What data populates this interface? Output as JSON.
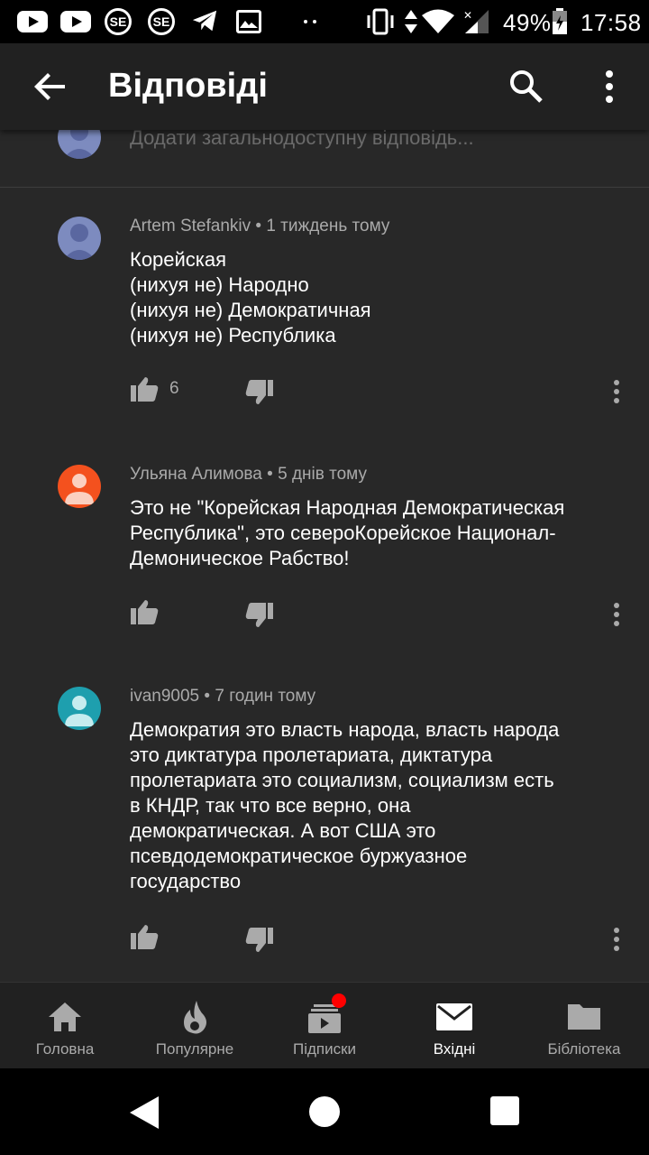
{
  "status_bar": {
    "battery": "49%",
    "time": "17:58",
    "icons": [
      "youtube-icon",
      "youtube-icon",
      "se-app-icon",
      "se-app-icon",
      "telegram-icon",
      "image-icon",
      "more-notifications-icon",
      "vibrate-icon",
      "data-arrows-icon",
      "wifi-icon",
      "signal-icon",
      "battery-icon"
    ],
    "se_label": "SE"
  },
  "app_bar": {
    "title": "Відповіді",
    "back_icon": "arrow-left-icon",
    "search_icon": "search-icon",
    "more_icon": "more-vertical-icon"
  },
  "reply_box": {
    "placeholder": "Додати загальнодоступну відповідь..."
  },
  "comments": [
    {
      "author": "Artem Stefankiv",
      "time": "1 тиждень тому",
      "text": "Корейская\n(нихуя не) Народно\n(нихуя не) Демократичная\n(нихуя не) Республика",
      "likes": "6",
      "avatar_color": "#7d8bbf",
      "avatar_type": "default-silhouette"
    },
    {
      "author": "Ульяна Алимова",
      "time": "5 днів тому",
      "text": "Это не \"Корейская Народная Демократическая Республика\", это североКорейское Национал-Демоническое Рабство!",
      "likes": "",
      "avatar_color": "#f4511e",
      "avatar_type": "person"
    },
    {
      "author": "ivan9005",
      "time": "7 годин тому",
      "text": "Демократия это власть народа, власть народа это диктатура пролетариата, диктатура пролетариата это социализм, социализм есть в КНДР, так что все верно, она демократическая. А вот США это псевдодемократическое буржуазное государство",
      "likes": "",
      "avatar_color": "#1e9fae",
      "avatar_type": "person"
    }
  ],
  "bottom_nav": [
    {
      "label": "Головна",
      "icon": "home-icon",
      "active": false
    },
    {
      "label": "Популярне",
      "icon": "trending-flame-icon",
      "active": false
    },
    {
      "label": "Підписки",
      "icon": "subscriptions-icon",
      "active": false,
      "badge": true
    },
    {
      "label": "Вхідні",
      "icon": "inbox-mail-icon",
      "active": true
    },
    {
      "label": "Бібліотека",
      "icon": "library-folder-icon",
      "active": false
    }
  ],
  "colors": {
    "background": "#282828",
    "app_bar": "#212121",
    "meta_text": "#aaaaaa",
    "badge": "#ff0000"
  }
}
